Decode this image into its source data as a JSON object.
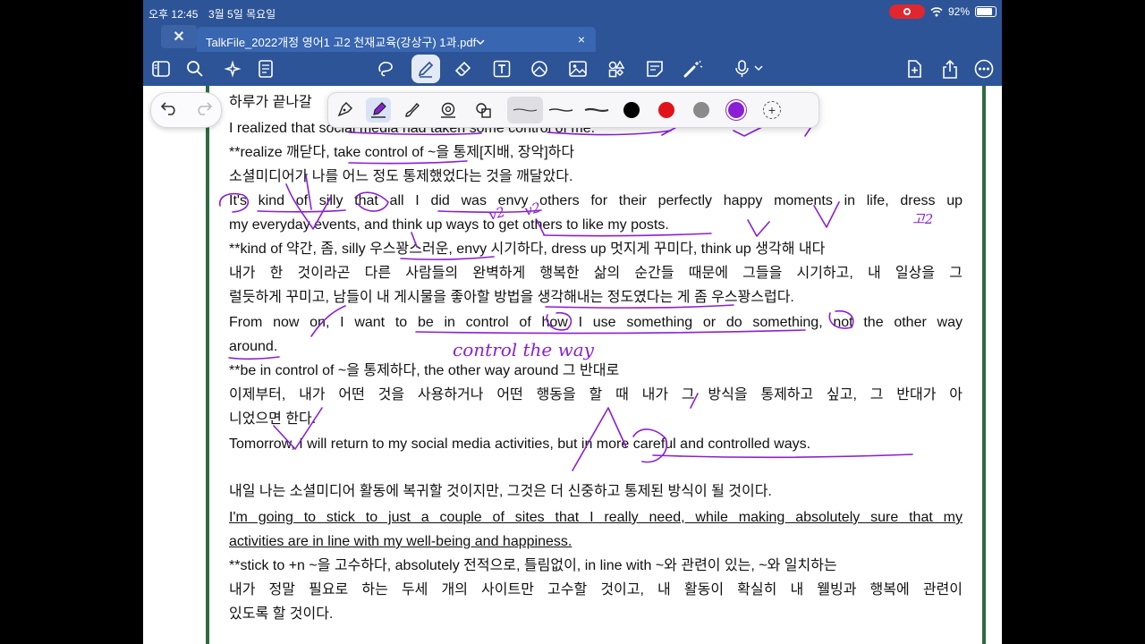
{
  "status_bar": {
    "time": "오후 12:45",
    "date": "3월 5일 목요일",
    "battery": "92%",
    "battery_level": 0.92
  },
  "tab": {
    "title": "TalkFile_2022개정 영어1 고2 천재교육(강상구) 1과.pdf",
    "chevron": "⌄",
    "close": "×"
  },
  "toolbar": {
    "left_icons": [
      "sidebar-icon",
      "search-icon",
      "ai-sparkle-icon",
      "document-list-icon"
    ],
    "tool_icons": [
      "lasso-icon",
      "pen-icon",
      "eraser-icon",
      "text-box-icon",
      "shape-icon",
      "image-icon",
      "element-icon",
      "sticky-note-icon",
      "laser-pointer-icon",
      "microphone-icon"
    ],
    "right_icons": [
      "add-page-icon",
      "share-icon",
      "more-icon"
    ],
    "active_tool": "pen-icon"
  },
  "pen_palette": {
    "tools": [
      "fountain-pen-icon",
      "highlighter-icon",
      "brush-icon",
      "shape-recognition-icon",
      "pressure-icon"
    ],
    "active_tool": "highlighter-icon",
    "colors": [
      "#000000",
      "#e0131a",
      "#8a8a8a",
      "#8a1fd6"
    ],
    "selected_color": "#8a1fd6"
  },
  "document": {
    "lines": [
      "하루가 끝나갈",
      "I realized that social media had taken some control of me.",
      "**realize 깨닫다, take control of ~을 통제[지배, 장악]하다",
      "소셜미디어가 나를 어느 정도 통제했었다는 것을 깨달았다.",
      "It's kind of silly that all I did was envy others for their perfectly happy moments in life, dress up",
      "my everyday events, and think up ways to get others to like my posts.",
      "**kind of 약간, 좀, silly 우스꽝스러운, envy 시기하다, dress up 멋지게 꾸미다, think up 생각해 내다",
      "내가 한 것이라곤 다른 사람들의 완벽하게 행복한 삶의 순간들 때문에 그들을 시기하고, 내 일상을 그",
      "럴듯하게 꾸미고, 남들이 내 게시물을 좋아할 방법을 생각해내는 정도였다는 게 좀 우스꽝스럽다.",
      "From now on, I want to be in control of how I use something or do something, not the other way",
      "around.",
      "**be in control of ~을 통제하다, the other way around 그 반대로",
      "이제부터, 내가 어떤 것을 사용하거나 어떤 행동을 할 때 내가 그 방식을 통제하고 싶고, 그 반대가 아",
      "니었으면 한다.",
      "Tomorrow, I will return to my social media activities, but in more careful and controlled ways.",
      "내일 나는 소셜미디어 활동에 복귀할 것이지만, 그것은 더 신중하고 통제된 방식이 될 것이다.",
      "I'm going to stick to just a couple of sites that I really need, while making absolutely sure that my",
      "activities are in line with my well-being and happiness.",
      "**stick to +n ~을 고수하다, absolutely 전적으로, 틀림없이, in line with ~와 관련이 있는, ~와 일치하는",
      "내가 정말 필요로 하는 두세 개의 사이트만 고수할 것이고, 내 활동이 확실히 내 웰빙과 행복에 관련이",
      "있도록 할 것이다."
    ]
  },
  "handwriting": {
    "notes": [
      "control the way",
      "v2",
      "v2",
      "고2"
    ]
  }
}
